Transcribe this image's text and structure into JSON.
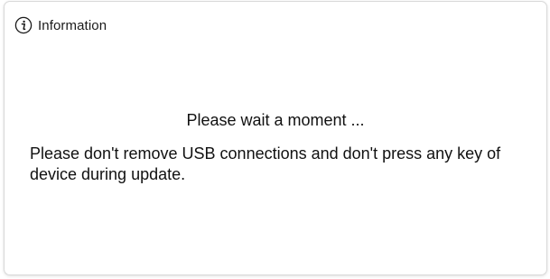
{
  "window": {
    "title": "Information",
    "icon": "info-icon"
  },
  "message": {
    "main": "Please wait a moment ...",
    "detail": "Please don't remove USB connections and don't press any key of device during update."
  },
  "colors": {
    "background": "#ffffff",
    "text": "#111111",
    "border": "#d9d9d9"
  }
}
